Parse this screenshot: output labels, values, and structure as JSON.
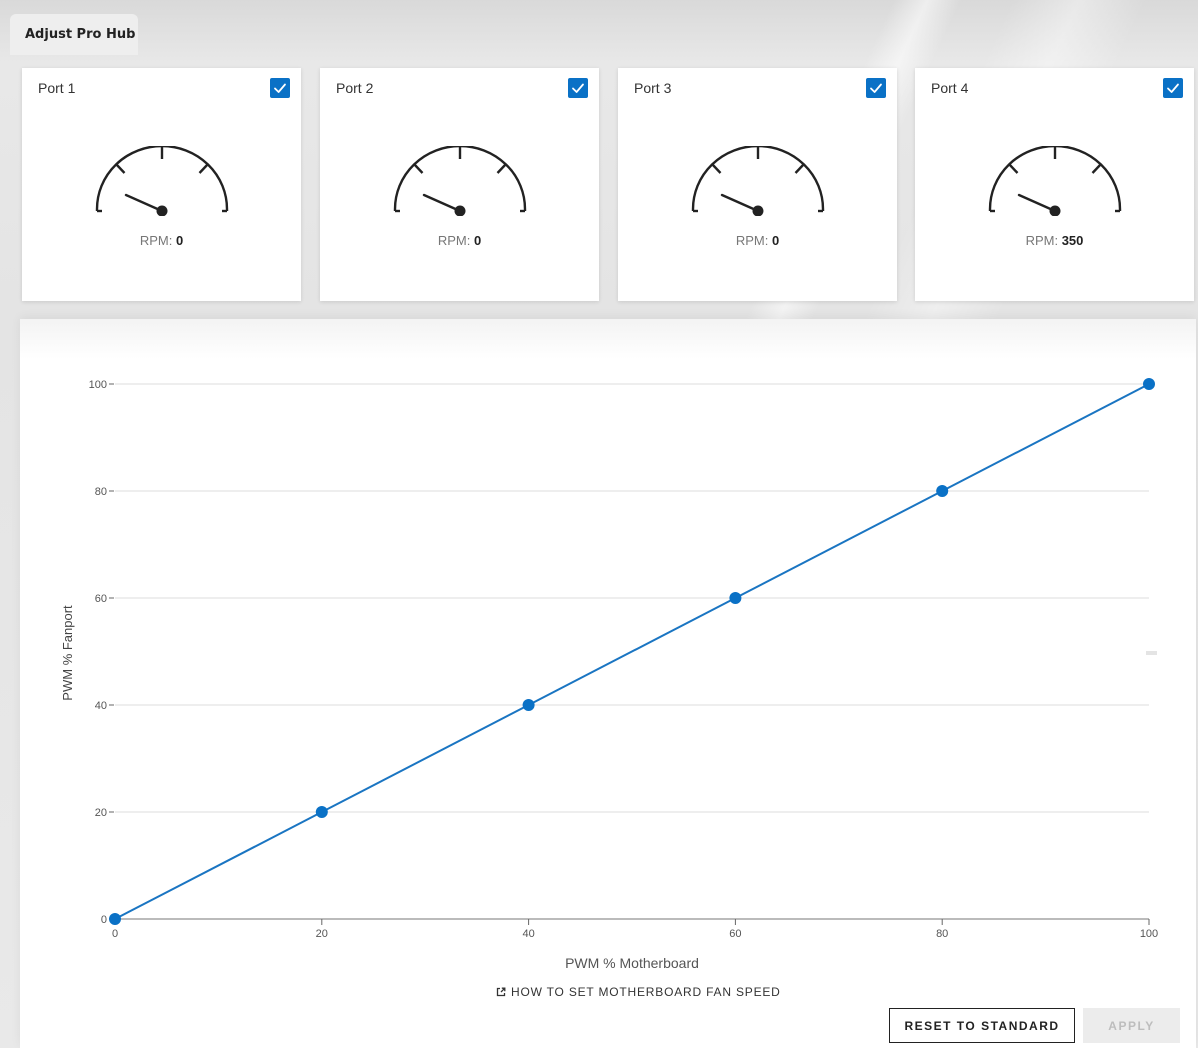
{
  "tab": {
    "label": "Adjust Pro Hub"
  },
  "ports": [
    {
      "title": "Port 1",
      "checked": true,
      "rpm_label": "RPM:",
      "rpm_value": "0"
    },
    {
      "title": "Port 2",
      "checked": true,
      "rpm_label": "RPM:",
      "rpm_value": "0"
    },
    {
      "title": "Port 3",
      "checked": true,
      "rpm_label": "RPM:",
      "rpm_value": "0"
    },
    {
      "title": "Port 4",
      "checked": true,
      "rpm_label": "RPM:",
      "rpm_value": "350"
    }
  ],
  "colors": {
    "accent": "#0a71c6",
    "line": "#1a75c2",
    "grid": "#dddddd"
  },
  "chart_data": {
    "type": "line",
    "x": [
      0,
      20,
      40,
      60,
      80,
      100
    ],
    "series": [
      {
        "values": [
          0,
          20,
          40,
          60,
          80,
          100
        ]
      }
    ],
    "xlabel": "PWM % Motherboard",
    "ylabel": "PWM % Fanport",
    "xlim": [
      0,
      100
    ],
    "ylim": [
      0,
      100
    ],
    "xticks": [
      "0",
      "20",
      "40",
      "60",
      "80",
      "100"
    ],
    "yticks": [
      "0",
      "20",
      "40",
      "60",
      "80",
      "100"
    ],
    "grid": "horizontal"
  },
  "links": {
    "howto": "HOW TO SET MOTHERBOARD FAN SPEED"
  },
  "buttons": {
    "reset": "RESET TO STANDARD",
    "apply": "APPLY"
  }
}
